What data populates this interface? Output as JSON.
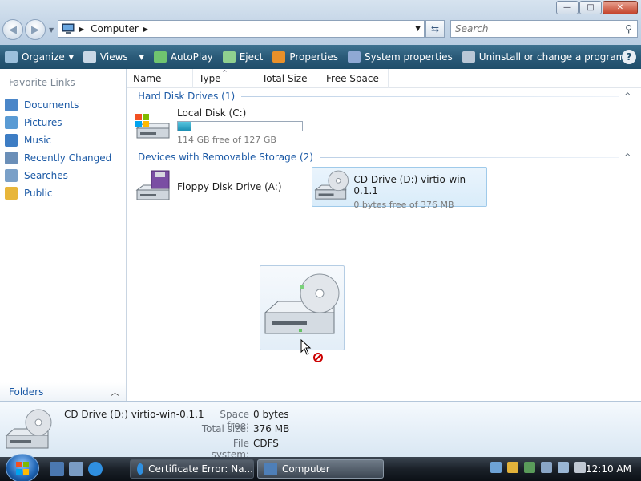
{
  "window": {
    "buttons": {
      "minimize": "—",
      "maximize": "□",
      "close": "✕"
    }
  },
  "address": {
    "crumb": "Computer"
  },
  "search": {
    "placeholder": "Search"
  },
  "toolbar": {
    "organize": "Organize",
    "views": "Views",
    "autoplay": "AutoPlay",
    "eject": "Eject",
    "properties": "Properties",
    "system_properties": "System properties",
    "uninstall": "Uninstall or change a program",
    "help": "?"
  },
  "nav": {
    "heading": "Favorite Links",
    "items": [
      {
        "label": "Documents",
        "icon": "documents-icon",
        "color": "#4a86c8"
      },
      {
        "label": "Pictures",
        "icon": "pictures-icon",
        "color": "#5a9bd4"
      },
      {
        "label": "Music",
        "icon": "music-icon",
        "color": "#3d7dc4"
      },
      {
        "label": "Recently Changed",
        "icon": "recent-icon",
        "color": "#6b8fb8"
      },
      {
        "label": "Searches",
        "icon": "searches-icon",
        "color": "#7aa0c8"
      },
      {
        "label": "Public",
        "icon": "public-icon",
        "color": "#e8b63a"
      }
    ],
    "folders": "Folders"
  },
  "columns": [
    "Name",
    "Type",
    "Total Size",
    "Free Space"
  ],
  "groups": {
    "hard_disks": "Hard Disk Drives (1)",
    "removable": "Devices with Removable Storage (2)"
  },
  "drives": {
    "local": {
      "name": "Local Disk (C:)",
      "sub": "114 GB free of 127 GB",
      "used_fraction": 0.1
    },
    "floppy": {
      "name": "Floppy Disk Drive (A:)"
    },
    "cd": {
      "name": "CD Drive (D:) virtio-win-0.1.1",
      "sub": "0 bytes free of 376 MB"
    }
  },
  "details": {
    "name": "CD Drive (D:) virtio-win-0.1.1",
    "space_free_label": "Space free:",
    "space_free": "0 bytes",
    "total_size_label": "Total size:",
    "total_size": "376 MB",
    "file_system_label": "File system:",
    "file_system": "CDFS"
  },
  "taskbar": {
    "tasks": [
      "Certificate Error: Na...",
      "Computer"
    ],
    "clock": "12:10 AM"
  },
  "colors": {
    "toolbar": "#2a5a78",
    "link": "#1c5aa6",
    "selection": "#d9ecfa"
  }
}
